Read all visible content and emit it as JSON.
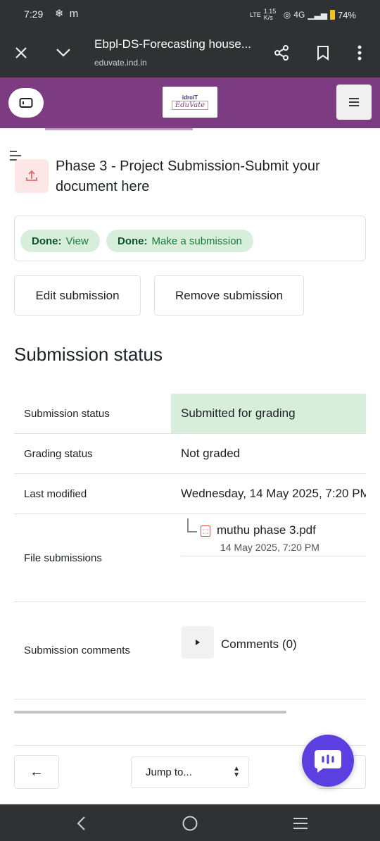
{
  "statusbar": {
    "time": "7:29",
    "left_icons": "❄ m",
    "net_label": "LTE",
    "speed": "1.15 K/s",
    "signal": "4G",
    "battery": "74%"
  },
  "browser": {
    "title": "Ebpl-DS-Forecasting house...",
    "url": "eduvate.ind.in"
  },
  "site": {
    "logo_top": "idroiT",
    "logo_main": "EduVate"
  },
  "page": {
    "title": "Phase 3 - Project Submission-Submit your document here"
  },
  "completion": [
    {
      "label": "Done:",
      "value": "View"
    },
    {
      "label": "Done:",
      "value": "Make a submission"
    }
  ],
  "actions": {
    "edit": "Edit submission",
    "remove": "Remove submission"
  },
  "status": {
    "heading": "Submission status",
    "rows": {
      "submission_status": {
        "label": "Submission status",
        "value": "Submitted for grading"
      },
      "grading_status": {
        "label": "Grading status",
        "value": "Not graded"
      },
      "last_modified": {
        "label": "Last modified",
        "value": "Wednesday, 14 May 2025, 7:20 PM"
      },
      "file_submissions": {
        "label": "File submissions",
        "file_name": "muthu phase 3.pdf",
        "file_date": "14 May 2025, 7:20 PM"
      },
      "submission_comments": {
        "label": "Submission comments",
        "value": "Comments (0)"
      }
    }
  },
  "footer_nav": {
    "back": "←",
    "jump_to": "Jump to..."
  },
  "colors": {
    "site_bar": "#7d3b82",
    "success_bg": "#d7efda",
    "chat": "#5b3fe0"
  }
}
